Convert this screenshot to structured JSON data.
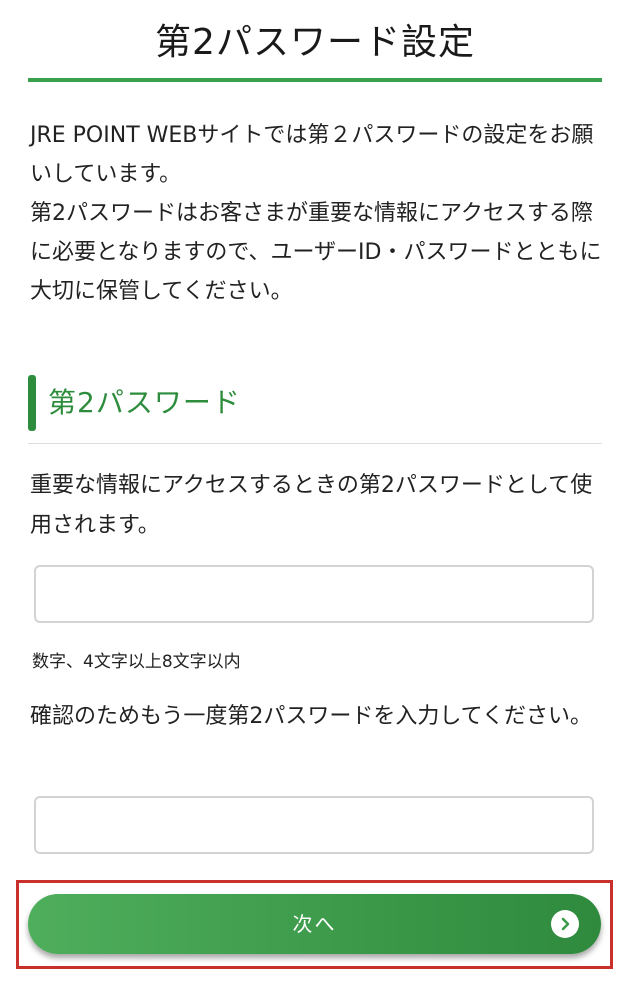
{
  "page": {
    "title": "第2パスワード設定",
    "intro": [
      "JRE POINT WEBサイトでは第２パスワードの設定をお願いしています。",
      "第2パスワードはお客さまが重要な情報にアクセスする際に必要となりますので、ユーザーID・パスワードとともに大切に保管してください。"
    ]
  },
  "section": {
    "title": "第2パスワード"
  },
  "form": {
    "password_description": "重要な情報にアクセスするときの第2パスワードとして使用されます。",
    "password_value": "",
    "password_hint": "数字、4文字以上8文字以内",
    "confirm_description": "確認のためもう一度第2パスワードを入力してください。",
    "confirm_value": ""
  },
  "actions": {
    "next_label": "次へ",
    "next_icon": "chevron-right-icon"
  },
  "colors": {
    "accent_green": "#3aa14a",
    "section_green": "#2e8d3d",
    "highlight_red": "#c9302c"
  }
}
